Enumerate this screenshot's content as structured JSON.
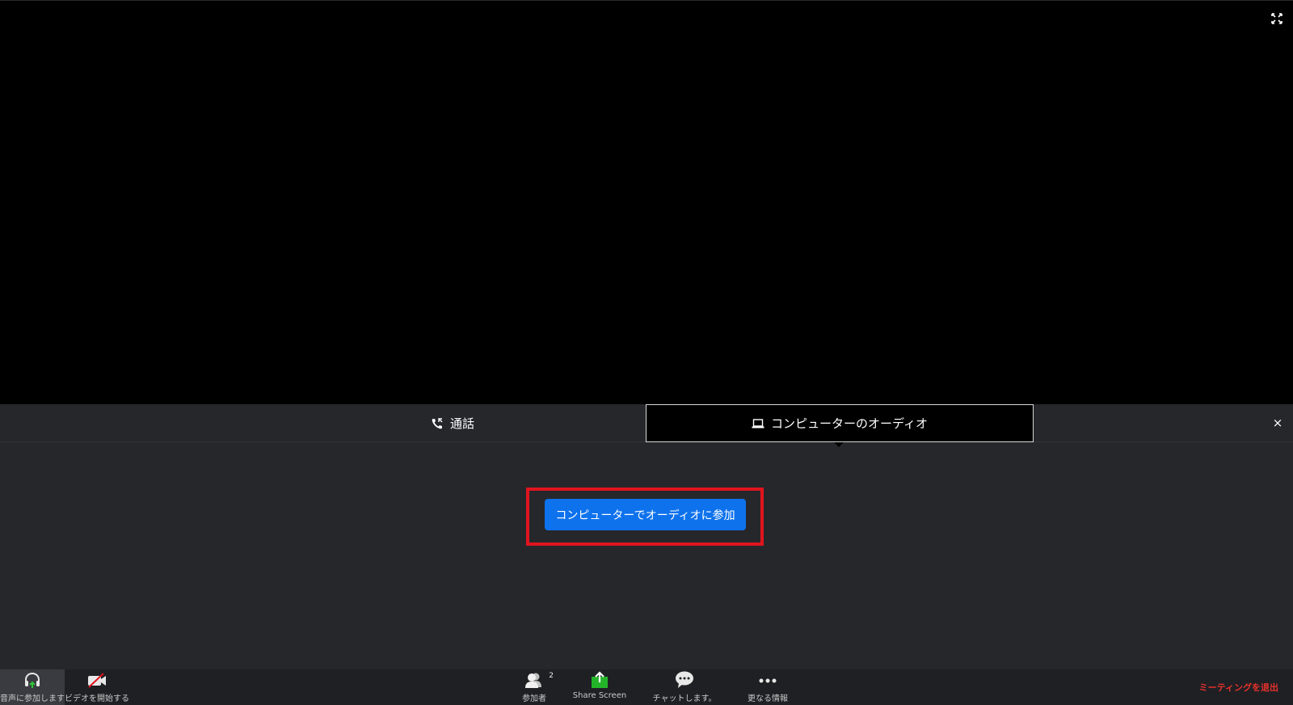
{
  "tabs": {
    "phone_label": "通話",
    "computer_label": "コンピューターのオーディオ"
  },
  "panel": {
    "close_label": "×",
    "join_button_label": "コンピューターでオーディオに参加"
  },
  "toolbar": {
    "audio_label": "音声に参加します",
    "video_label": "ビデオを開始する",
    "participants_label": "参加者",
    "participants_count": "2",
    "share_label": "Share Screen",
    "chat_label": "チャットします。",
    "more_label": "更なる情報",
    "leave_label": "ミーティングを退出"
  },
  "colors": {
    "join_button": "#0e72ed",
    "highlight": "#e0141e",
    "leave": "#e5312b",
    "share_icon": "#24b42a",
    "audio_arrow": "#2fc43a",
    "video_slash": "#e0141e"
  },
  "icons": {
    "fullscreen": "fullscreen-icon",
    "phone": "phone-call-icon",
    "computer": "laptop-icon",
    "audio": "headphones-icon",
    "video": "video-off-icon",
    "participants": "participants-icon",
    "share": "share-screen-icon",
    "chat": "chat-bubble-icon",
    "more": "more-dots-icon"
  }
}
